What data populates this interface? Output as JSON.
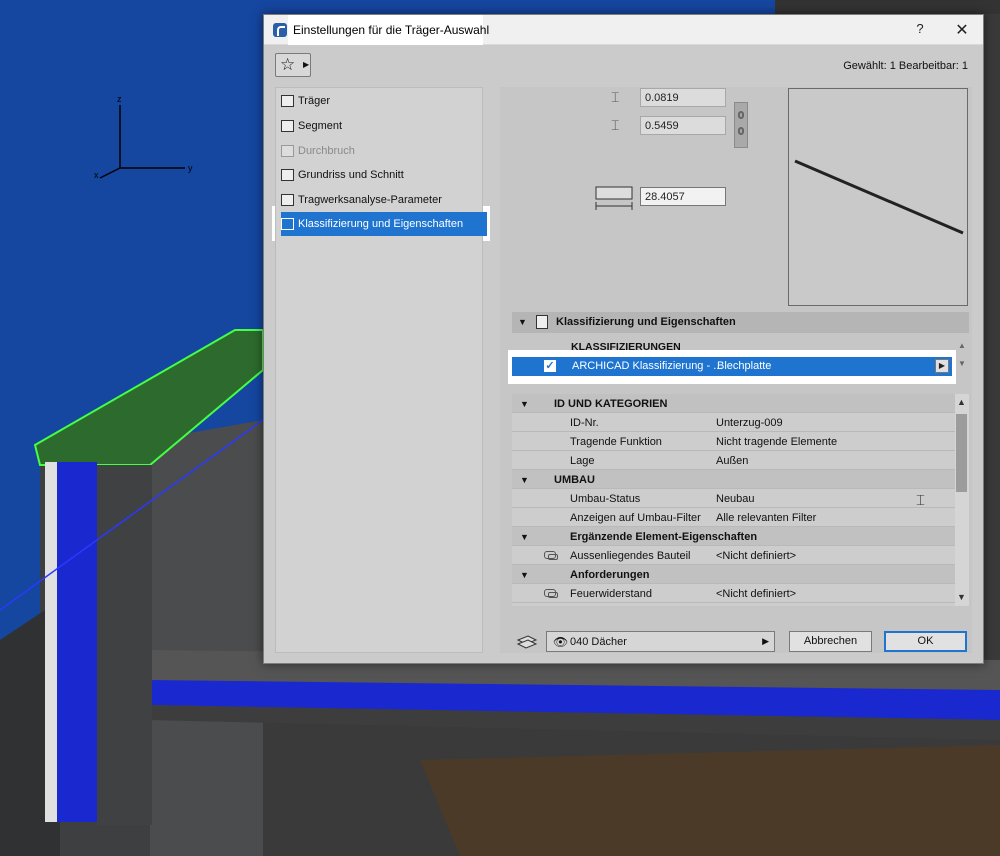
{
  "dialog": {
    "title": "Einstellungen für die Träger-Auswahl",
    "help": "?",
    "close": "✕",
    "selection_info": "Gewählt: 1 Bearbeitbar: 1"
  },
  "nav": {
    "items": [
      {
        "label": "Träger",
        "icon": "beam-icon"
      },
      {
        "label": "Segment",
        "icon": "segment-icon"
      },
      {
        "label": "Durchbruch",
        "icon": "hole-icon"
      },
      {
        "label": "Grundriss und Schnitt",
        "icon": "floorplan-icon"
      },
      {
        "label": "Tragwerksanalyse-Parameter",
        "icon": "structural-icon"
      },
      {
        "label": "Klassifizierung und Eigenschaften",
        "icon": "classification-icon"
      }
    ]
  },
  "dims": {
    "width": "0.0819",
    "height": "0.5459",
    "length": "28.4057"
  },
  "section": {
    "title": "Klassifizierung und Eigenschaften"
  },
  "classifications": {
    "heading": "KLASSIFIZIERUNGEN",
    "item_label": "ARCHICAD Klassifizierung - ...",
    "item_value": "Blechplatte"
  },
  "properties": {
    "rows": [
      {
        "type": "group",
        "label": "ID UND KATEGORIEN",
        "value": ""
      },
      {
        "type": "item",
        "label": "ID-Nr.",
        "value": "Unterzug-009"
      },
      {
        "type": "item",
        "label": "Tragende Funktion",
        "value": "Nicht tragende Elemente"
      },
      {
        "type": "item",
        "label": "Lage",
        "value": "Außen"
      },
      {
        "type": "group",
        "label": "UMBAU",
        "value": ""
      },
      {
        "type": "item",
        "label": "Umbau-Status",
        "value": "Neubau"
      },
      {
        "type": "item",
        "label": "Anzeigen auf Umbau-Filter",
        "value": "Alle relevanten Filter"
      },
      {
        "type": "group",
        "label": "Ergänzende Element-Eigenschaften",
        "value": ""
      },
      {
        "type": "linked",
        "label": "Aussenliegendes Bauteil",
        "value": "<Nicht definiert>"
      },
      {
        "type": "group",
        "label": "Anforderungen",
        "value": ""
      },
      {
        "type": "linked",
        "label": "Feuerwiderstand",
        "value": "<Nicht definiert>"
      }
    ]
  },
  "footer": {
    "layer": "040 Dächer",
    "cancel": "Abbrechen",
    "ok": "OK"
  },
  "axes": {
    "x": "x",
    "y": "y",
    "z": "z"
  }
}
